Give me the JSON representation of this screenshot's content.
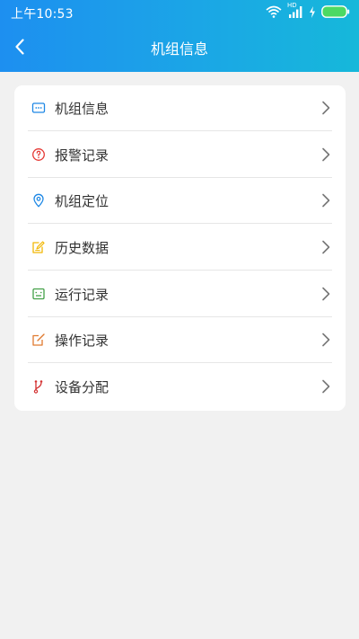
{
  "status_bar": {
    "time": "上午10:53",
    "network_label": "HD",
    "icons": [
      "wifi-icon",
      "signal-icon",
      "charging-icon",
      "battery-icon"
    ]
  },
  "header": {
    "title": "机组信息",
    "back_icon": "chevron-left-icon"
  },
  "menu": {
    "items": [
      {
        "label": "机组信息",
        "icon": "monitor-icon",
        "icon_color": "#1e88e5"
      },
      {
        "label": "报警记录",
        "icon": "alert-circle-icon",
        "icon_color": "#e53935"
      },
      {
        "label": "机组定位",
        "icon": "location-pin-icon",
        "icon_color": "#1e88e5"
      },
      {
        "label": "历史数据",
        "icon": "edit-note-icon",
        "icon_color": "#f2b807"
      },
      {
        "label": "运行记录",
        "icon": "terminal-icon",
        "icon_color": "#43a047"
      },
      {
        "label": "操作记录",
        "icon": "edit-box-icon",
        "icon_color": "#e07a2f"
      },
      {
        "label": "设备分配",
        "icon": "branch-icon",
        "icon_color": "#d32f2f"
      }
    ],
    "chevron_icon": "chevron-right-icon"
  },
  "colors": {
    "header_start": "#1d8ff0",
    "header_end": "#16b8da",
    "page_background": "#f1f1f1",
    "card_background": "#ffffff",
    "battery": "#4cd964"
  }
}
